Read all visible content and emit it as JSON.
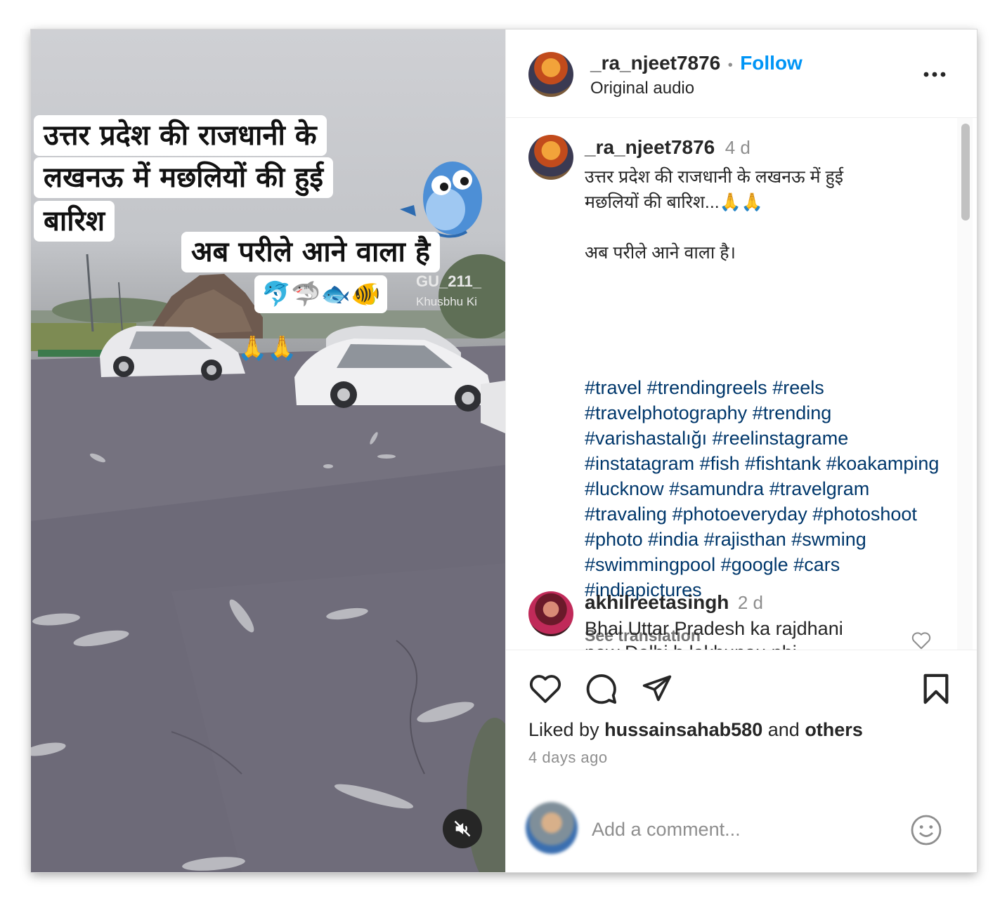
{
  "video": {
    "overlay_lines": [
      "उत्तर प्रदेश की राजधानी के",
      "लखनऊ में  मछलियों की हुई",
      "बारिश"
    ],
    "overlay_line2": "अब परीले आने वाला है",
    "emoji_row": "🐬🦈🐟🐠",
    "watermark_1": "GU_211_",
    "watermark_2": "Khusbhu Ki",
    "pray_emoji": "🙏🙏"
  },
  "header": {
    "username": "_ra_njeet7876",
    "separator": "•",
    "follow_label": "Follow",
    "audio_label": "Original audio",
    "more_icon": "more-horizontal-icon"
  },
  "caption": {
    "username": "_ra_njeet7876",
    "age": "4 d",
    "text": "उत्तर प्रदेश की राजधानी के लखनऊ में हुई\nमछलियों की बारिश...🙏🙏\n\nअब परीले आने वाला है।",
    "hashtags": [
      "#travel",
      "#trendingreels",
      "#reels",
      "#travelphotography",
      "#trending",
      "#varishastalığı",
      "#reelinstagrame",
      "#instatagram",
      "#fish",
      "#fishtank",
      "#koakamping",
      "#lucknow",
      "#samundra",
      "#travelgram",
      "#travaling",
      "#photoeveryday",
      "#photoshoot",
      "#photo",
      "#india",
      "#rajisthan",
      "#swming",
      "#swimmingpool",
      "#google",
      "#cars",
      "#indiapictures"
    ],
    "see_translation": "See translation"
  },
  "comment": {
    "username": "akhilreetasingh",
    "age": "2 d",
    "text_line1": "Bhai Uttar Pradesh ka rajdhani",
    "text_line2": "new Delhi h lakhunau nhi"
  },
  "actions": {
    "liked_by_prefix": "Liked by",
    "liked_by_user": "hussainsahab580",
    "and_label": "and",
    "others_label": "others",
    "date": "4 days ago",
    "add_comment_placeholder": "Add a comment..."
  },
  "colors": {
    "follow_blue": "#0095f6",
    "hashtag_blue": "#00376b",
    "muted_gray": "#8e8e8e"
  }
}
